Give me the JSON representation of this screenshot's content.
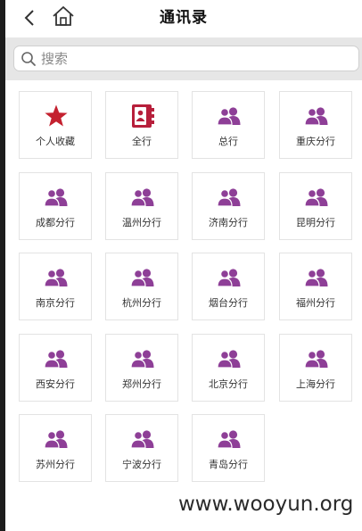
{
  "header": {
    "title": "通讯录"
  },
  "search": {
    "placeholder": "搜索"
  },
  "tiles": [
    {
      "label": "个人收藏",
      "icon": "star-icon"
    },
    {
      "label": "全行",
      "icon": "contact-book-icon"
    },
    {
      "label": "总行",
      "icon": "group-icon"
    },
    {
      "label": "重庆分行",
      "icon": "group-icon"
    },
    {
      "label": "成都分行",
      "icon": "group-icon"
    },
    {
      "label": "温州分行",
      "icon": "group-icon"
    },
    {
      "label": "济南分行",
      "icon": "group-icon"
    },
    {
      "label": "昆明分行",
      "icon": "group-icon"
    },
    {
      "label": "南京分行",
      "icon": "group-icon"
    },
    {
      "label": "杭州分行",
      "icon": "group-icon"
    },
    {
      "label": "烟台分行",
      "icon": "group-icon"
    },
    {
      "label": "福州分行",
      "icon": "group-icon"
    },
    {
      "label": "西安分行",
      "icon": "group-icon"
    },
    {
      "label": "郑州分行",
      "icon": "group-icon"
    },
    {
      "label": "北京分行",
      "icon": "group-icon"
    },
    {
      "label": "上海分行",
      "icon": "group-icon"
    },
    {
      "label": "苏州分行",
      "icon": "group-icon"
    },
    {
      "label": "宁波分行",
      "icon": "group-icon"
    },
    {
      "label": "青岛分行",
      "icon": "group-icon"
    }
  ],
  "colors": {
    "star": "#c4212f",
    "contact_book": "#b71f3b",
    "group": "#8e3f97"
  },
  "watermark": {
    "text": "www.wooyun.org"
  }
}
